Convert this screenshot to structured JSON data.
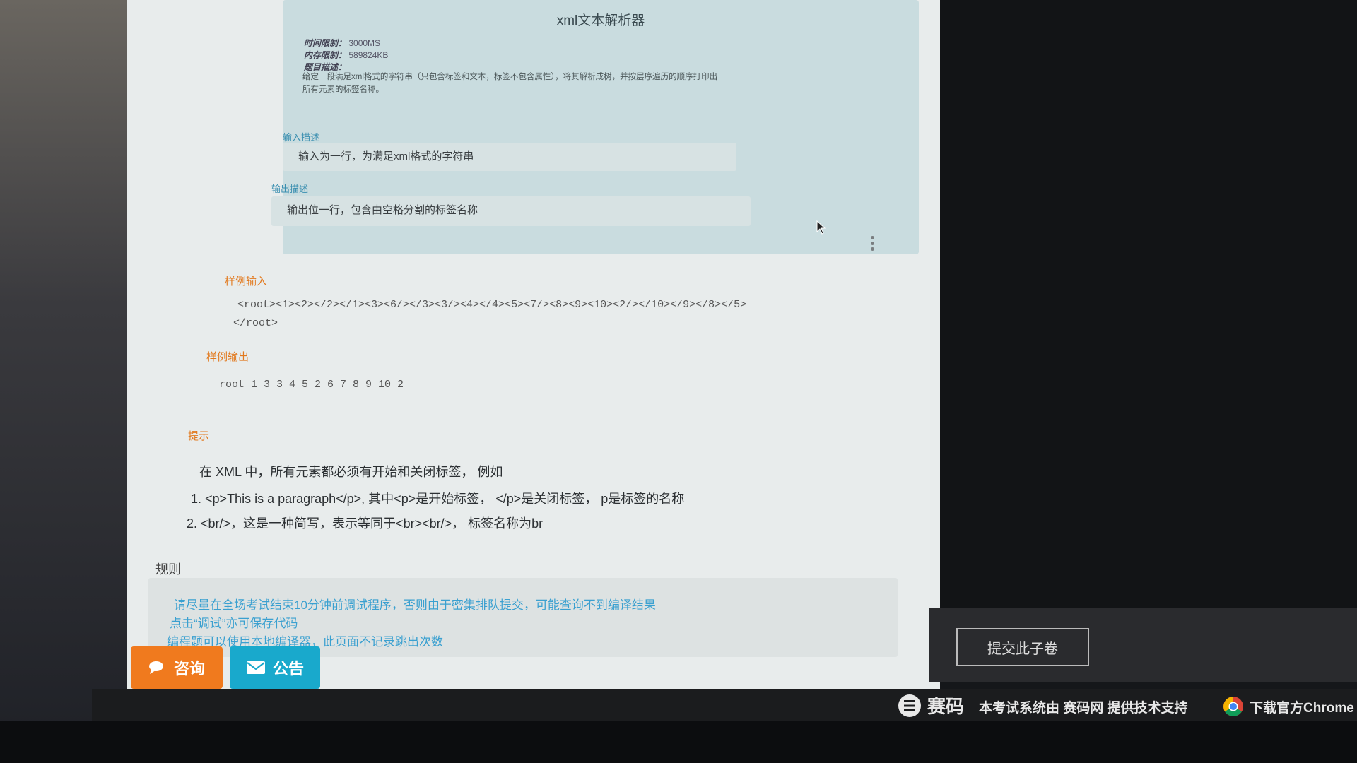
{
  "problem": {
    "title": "xml文本解析器",
    "time_limit_label": "时间限制：",
    "time_limit_value": "3000MS",
    "memory_limit_label": "内存限制：",
    "memory_limit_value": "589824KB",
    "description_label": "题目描述：",
    "description_line1": "给定一段满足xml格式的字符串（只包含标签和文本，标签不包含属性），将其解析成树，并按层序遍历的顺序打印出",
    "description_line2": "所有元素的标签名称。",
    "input_label": "输入描述",
    "input_text": "输入为一行，为满足xml格式的字符串",
    "output_label": "输出描述",
    "output_text": "输出位一行，包含由空格分割的标签名称"
  },
  "sample": {
    "input_label": "样例输入",
    "input_line1": "<root><1><2></2></1><3><6/></3><3/><4></4><5><7/><8><9><10><2/></10></9></8></5>",
    "input_line2": "</root>",
    "output_label": "样例输出",
    "output_text": "root 1 3 3 4 5 2 6 7 8 9 10 2"
  },
  "hint": {
    "label": "提示",
    "intro": "在 XML 中，所有元素都必须有开始和关闭标签，  例如",
    "item1_num": "1.",
    "item1": "<p>This is a paragraph</p>, 其中<p>是开始标签，  </p>是关闭标签，  p是标签的名称",
    "item2_num": "2.",
    "item2": "<br/>，这是一种简写，表示等同于<br><br/>，  标签名称为br"
  },
  "rules": {
    "label": "规则",
    "line1": "请尽量在全场考试结束10分钟前调试程序，否则由于密集排队提交，可能查询不到编译结果",
    "line2": "点击“调试”亦可保存代码",
    "line3": "编程题可以使用本地编译器，此页面不记录跳出次数"
  },
  "buttons": {
    "consult": "咨询",
    "notice": "公告",
    "submit": "提交此子卷"
  },
  "footer": {
    "brand": "赛码",
    "support": "本考试系统由 赛码网 提供技术支持",
    "chrome": "下载官方Chrome"
  },
  "colors": {
    "accent_orange": "#f07a1e",
    "accent_blue": "#19a9cc",
    "label_blue": "#3a8fb0"
  }
}
